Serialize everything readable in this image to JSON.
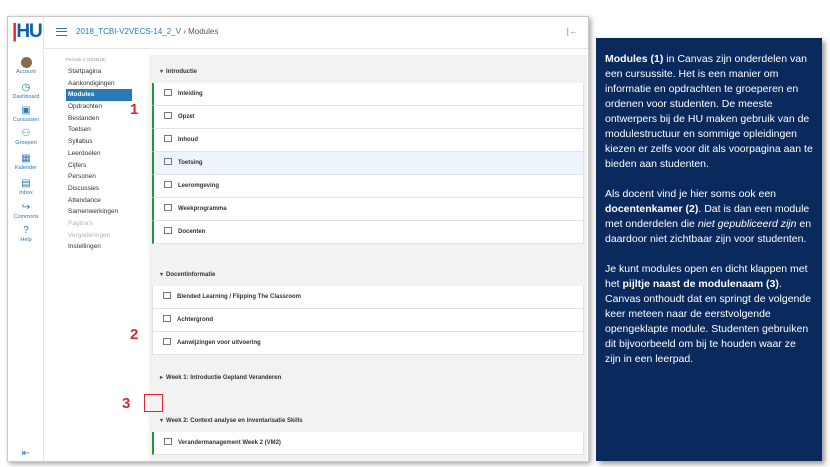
{
  "global_nav": {
    "logo_text": "HU",
    "items": [
      {
        "label": "Account",
        "icon": "account-avatar-icon"
      },
      {
        "label": "Dashboard",
        "icon": "dashboard-icon"
      },
      {
        "label": "Cursussen",
        "icon": "courses-icon"
      },
      {
        "label": "Groepen",
        "icon": "groups-icon"
      },
      {
        "label": "Kalender",
        "icon": "calendar-icon"
      },
      {
        "label": "Inbox",
        "icon": "inbox-icon"
      },
      {
        "label": "Commons",
        "icon": "commons-icon"
      },
      {
        "label": "Help",
        "icon": "help-icon"
      }
    ]
  },
  "header": {
    "course": "2018_TCBI-V2VECS-14_2_V",
    "separator": "›",
    "page": "Modules",
    "collapse_icon": "collapse-icon"
  },
  "course_nav": {
    "period": "Periode 4 (2018/19)",
    "items": [
      {
        "label": "Startpagina",
        "state": "normal"
      },
      {
        "label": "Aankondigingen",
        "state": "normal"
      },
      {
        "label": "Modules",
        "state": "active"
      },
      {
        "label": "Opdrachten",
        "state": "normal"
      },
      {
        "label": "Bestanden",
        "state": "normal"
      },
      {
        "label": "Toetsen",
        "state": "normal"
      },
      {
        "label": "Syllabus",
        "state": "normal"
      },
      {
        "label": "Leerdoelen",
        "state": "normal"
      },
      {
        "label": "Cijfers",
        "state": "normal"
      },
      {
        "label": "Personen",
        "state": "normal"
      },
      {
        "label": "Discussies",
        "state": "normal"
      },
      {
        "label": "Attendance",
        "state": "normal"
      },
      {
        "label": "Samenwerkingen",
        "state": "normal"
      },
      {
        "label": "Pagina's",
        "state": "muted"
      },
      {
        "label": "Vergaderingen",
        "state": "muted"
      },
      {
        "label": "Instellingen",
        "state": "normal"
      }
    ]
  },
  "modules": [
    {
      "title": "Introductie",
      "expanded": true,
      "published": true,
      "items": [
        "Inleiding",
        "Opzet",
        "Inhoud",
        "Toetsing",
        "Leeromgeving",
        "Weekprogramma",
        "Docenten"
      ]
    },
    {
      "title": "Docentinformatie",
      "expanded": true,
      "published": false,
      "items": [
        "Blended Learning / Flipping The Classroom",
        "Achtergrond",
        "Aanwijzingen voor uitvoering"
      ]
    },
    {
      "title": "Week 1: Introductie Gepland Veranderen",
      "expanded": false,
      "published": true,
      "items": []
    },
    {
      "title": "Week 2: Context analyse en inventarisatie Skills",
      "expanded": true,
      "published": true,
      "items": [
        "Verandermanagement Week 2 (VM2)"
      ]
    }
  ],
  "annotations": {
    "n1": "1",
    "n2": "2",
    "n3": "3"
  },
  "note": {
    "p1_b": "Modules (1)",
    "p1": " in Canvas zijn onderdelen van een cursussite. Het is een manier om informatie en opdrachten te groeperen en ordenen voor studenten. De meeste ontwerpers bij de HU maken gebruik van de modulestructuur en sommige opleidingen kiezen er zelfs voor dit als voorpagina aan te bieden aan studenten.",
    "p2_a": "Als docent vind je hier soms ook een ",
    "p2_b": "docentenkamer (2)",
    "p2_c": ". Dat is dan een module met onderdelen die ",
    "p2_i": "niet gepubliceerd zijn",
    "p2_d": " en daardoor niet zichtbaar zijn voor studenten.",
    "p3_a": "Je kunt modules open en dicht klappen met het ",
    "p3_b": "pijltje naast de modulenaam (3)",
    "p3_c": ". Canvas onthoudt dat en springt de volgende keer meteen naar de eerstvolgende opengeklapte module. Studenten gebruiken dit bijvoorbeeld om bij te houden waar ze zijn in een leerpad."
  }
}
